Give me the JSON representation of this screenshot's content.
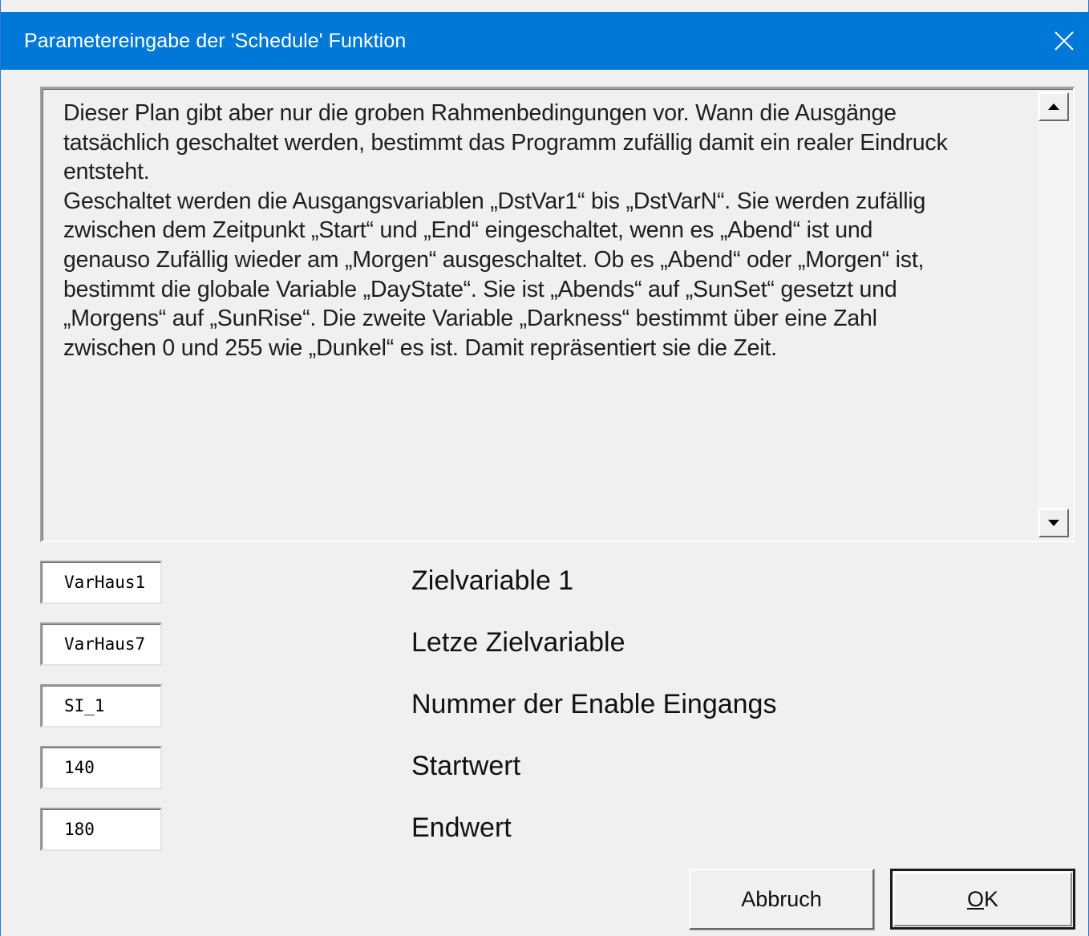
{
  "window": {
    "title": "Parametereingabe der 'Schedule' Funktion",
    "close_icon": "close-icon"
  },
  "description": {
    "text": "Dieser Plan gibt aber nur die groben Rahmenbedingungen vor. Wann die Ausgänge\ntatsächlich geschaltet werden, bestimmt das Programm zufällig damit ein realer Eindruck\nentsteht.\nGeschaltet werden die Ausgangsvariablen „DstVar1“ bis „DstVarN“. Sie werden zufällig\nzwischen dem Zeitpunkt „Start“ und „End“ eingeschaltet, wenn es „Abend“ ist und\ngenauso Zufällig wieder am „Morgen“ ausgeschaltet. Ob es „Abend“ oder „Morgen“ ist,\nbestimmt die globale Variable „DayState“. Sie ist „Abends“ auf „SunSet“ gesetzt und\n„Morgens“ auf „SunRise“. Die zweite Variable „Darkness“ bestimmt über eine Zahl\nzwischen 0 und 255 wie „Dunkel“ es ist. Damit repräsentiert sie die Zeit."
  },
  "fields": [
    {
      "value": "VarHaus1",
      "label": "Zielvariable 1"
    },
    {
      "value": "VarHaus7",
      "label": "Letze Zielvariable"
    },
    {
      "value": "SI_1",
      "label": "Nummer der Enable Eingangs"
    },
    {
      "value": "140",
      "label": "Startwert"
    },
    {
      "value": "180",
      "label": "Endwert"
    }
  ],
  "buttons": {
    "cancel": "Abbruch",
    "ok_mnemonic": "O",
    "ok_rest": "K"
  },
  "colors": {
    "titlebar": "#0078d7",
    "background": "#f0f0f0"
  }
}
